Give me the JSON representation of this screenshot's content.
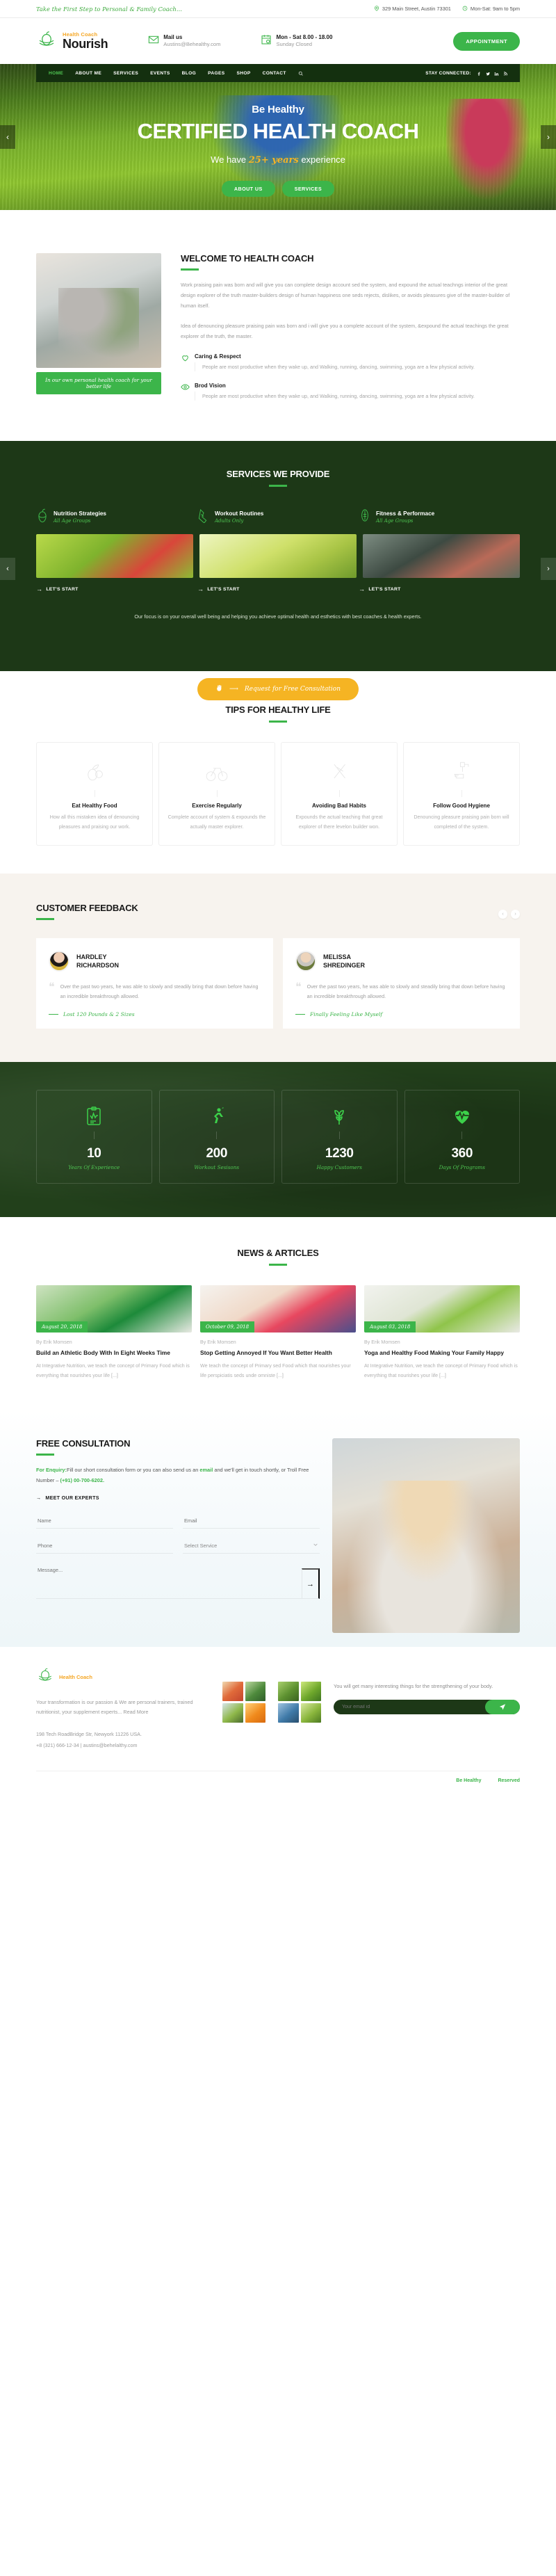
{
  "topbar": {
    "tagline": "Take the First Step to Personal & Family Coach...",
    "address": "329 Main Street, Austin 73301",
    "hours": "Mon-Sat: 9am to 5pm"
  },
  "header": {
    "brand_sup": "Health Coach",
    "brand_name": "Nourish",
    "mail_label": "Mail us",
    "mail_value": "Austins@Behealthy.com",
    "hours_label": "Mon - Sat 8.00 - 18.00",
    "hours_value": "Sunday Closed",
    "appointment_button": "APPOINTMENT"
  },
  "nav": {
    "items": [
      {
        "label": "HOME",
        "active": true
      },
      {
        "label": "ABOUT ME",
        "active": false
      },
      {
        "label": "SERVICES",
        "active": false
      },
      {
        "label": "EVENTS",
        "active": false
      },
      {
        "label": "BLOG",
        "active": false
      },
      {
        "label": "PAGES",
        "active": false
      },
      {
        "label": "SHOP",
        "active": false
      },
      {
        "label": "CONTACT",
        "active": false
      }
    ],
    "stay_connected": "STAY CONNECTED:",
    "socials": [
      "facebook-icon",
      "twitter-icon",
      "linkedin-icon",
      "rss-icon"
    ]
  },
  "hero": {
    "eyebrow": "Be Healthy",
    "title": "CERTIFIED HEALTH COACH",
    "sub_pre": "We have ",
    "sub_accent": "25+ years",
    "sub_post": " experience",
    "btn_primary": "ABOUT US",
    "btn_secondary": "SERVICES",
    "prev": "‹",
    "next": "›"
  },
  "welcome": {
    "title": "WELCOME TO HEALTH COACH",
    "para1": "Work praising pain was born and will give you can complete design account sed the system, and expound the actual teachngs interior of the great design explorer of the truth master-builders design of human happiness one seds rejects, dislikes, or avoids pleasures give of the master-builder of human itself.",
    "para2": "Idea of denouncing pleasure praising pain was born and i will give you a complete account of the system, &expound the actual teachings the great explorer of the truth, the master.",
    "caption": "In our own personal health coach for your better life",
    "features": [
      {
        "icon": "heart-icon",
        "title": "Caring & Respect",
        "text": "People are most productive when they wake up, and Walking, running, dancing, swimming, yoga are a few physical activity."
      },
      {
        "icon": "eye-icon",
        "title": "Brod Vision",
        "text": "People are most productive when they wake up, and Walking, running, dancing, swimming, yoga are a few physical activity."
      }
    ]
  },
  "services": {
    "title": "SERVICES WE PROVIDE",
    "items": [
      {
        "icon": "nutrition-icon",
        "name": "Nutrition Strategies",
        "sub": "All Age Groups",
        "link": "LET'S START"
      },
      {
        "icon": "shoe-icon",
        "name": "Workout Routines",
        "sub": "Adults Only",
        "link": "LET'S START"
      },
      {
        "icon": "ball-icon",
        "name": "Fitness & Performace",
        "sub": "All Age Groups",
        "link": "LET'S START"
      }
    ],
    "description": "Our focus is on your overall well being and helping you achieve optimal health and esthetics with best coaches & health experts.",
    "cta": "Request for Free Consultation",
    "prev": "‹",
    "next": "›"
  },
  "tips": {
    "title": "TIPS FOR HEALTHY LIFE",
    "cards": [
      {
        "icon": "fruit-icon",
        "title": "Eat Healthy Food",
        "text": "How all this mistaken idea of denouncing pleasures and praising our work."
      },
      {
        "icon": "bicycle-icon",
        "title": "Exercise Regularly",
        "text": "Complete account of system & expounds the actually master explorer."
      },
      {
        "icon": "no-smoking-icon",
        "title": "Avoiding Bad Habits",
        "text": "Expounds the actual teaching that great explorer of there levelon builder won."
      },
      {
        "icon": "hand-wash-icon",
        "title": "Follow Good Hygiene",
        "text": "Denouncing pleasure praising pain born will completed of the system."
      }
    ]
  },
  "feedback": {
    "title": "CUSTOMER FEEDBACK",
    "prev": "‹",
    "next": "›",
    "cards": [
      {
        "avatar": "avatar-hardley",
        "name": "HARDLEY\nRICHARDSON",
        "quote": "Over the past two years, he was able to slowly and steadily bring that down before having an incredible breakthrough allowed.",
        "tag": "Lost 120 Pounds & 2 Sizes"
      },
      {
        "avatar": "avatar-melissa",
        "name": "MELISSA\nSHREDINGER",
        "quote": "Over the past two years, he was able to slowly and steadily bring that down before having an incredible breakthrough allowed.",
        "tag": "Finally Feeling Like Myself"
      }
    ]
  },
  "counters": [
    {
      "icon": "clipboard-icon",
      "number": "10",
      "label": "Years Of Experience"
    },
    {
      "icon": "runner-icon",
      "number": "200",
      "label": "Workout Sesisons"
    },
    {
      "icon": "plant-icon",
      "number": "1230",
      "label": "Happy Customers"
    },
    {
      "icon": "heartbeat-icon",
      "number": "360",
      "label": "Days Of Programs"
    }
  ],
  "news": {
    "title": "NEWS & ARTICLES",
    "posts": [
      {
        "date": "August 20, 2018",
        "by": "By Erik Momsen",
        "title": "Build an Athletic Body With In Eight Weeks Time",
        "excerpt": "At Integrative Nutrition, we teach the concept of Primary Food which is everything that nourishes your life [...]"
      },
      {
        "date": "October 09, 2018",
        "by": "By Erik Momsen",
        "title": "Stop Getting Annoyed If You Want Better Health",
        "excerpt": "We teach the concept of Primary sed Food which that nourishes your life perspiciatis seds unde omniste [...]"
      },
      {
        "date": "August 03, 2018",
        "by": "By Erik Momsen",
        "title": "Yoga and Healthy Food Making Your Family Happy",
        "excerpt": "At Integrative Nutrition, we teach the concept of Primary Food which is everything that nourishes your life [...]"
      }
    ]
  },
  "consult": {
    "title": "FREE CONSULTATION",
    "note_1": "For Enquiry:",
    "note_2": "Fill our short consultation form or you can also send us an ",
    "note_3": "email",
    "note_4": " and we'll get in touch shortly, or Troll Free Number – ",
    "note_5": "(+91) 00-700-6202.",
    "meet_link": "MEET OUR EXPERTS",
    "name_placeholder": "Name",
    "email_placeholder": "Email",
    "phone_placeholder": "Phone",
    "service_value": "Select Service",
    "message_placeholder": "Message...",
    "send": "→"
  },
  "footer": {
    "brand_sup": "Health Coach",
    "about": "Your transformation is our passion & We are personal trainers, trained nutritionist, your supplement experts... Read More",
    "address": "198 Tech RoadBridge Str, Newyork 11226 USA.",
    "contact": "+8 (321) 666-12-34 | austins@behelalthy.com",
    "newsletter_text": "You will get many interesting things for the strengthening of your body.",
    "newsletter_placeholder": "Your email id",
    "copyright": "",
    "links": [
      "Be Healthy",
      "Reserved"
    ]
  }
}
